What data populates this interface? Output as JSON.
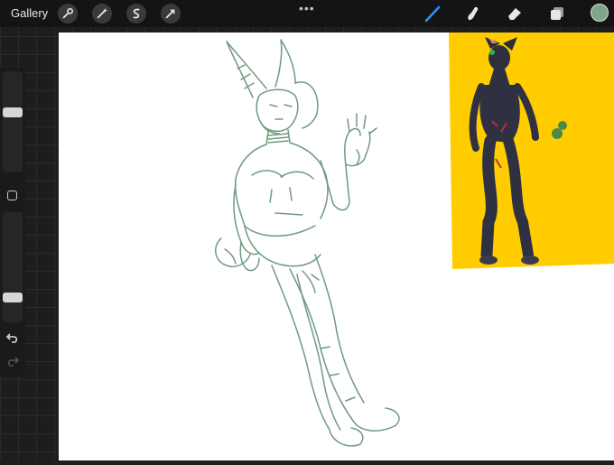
{
  "toolbar": {
    "gallery_label": "Gallery",
    "left_tools": [
      "wrench-icon",
      "magic-wand-icon",
      "selection-icon",
      "transform-arrow-icon"
    ],
    "more_label": "•••",
    "right_tools": [
      "brush-icon",
      "smudge-icon",
      "eraser-icon",
      "layers-icon"
    ],
    "active_tool": "brush",
    "active_color": "#7fa58c"
  },
  "sidebar": {
    "brush_size_fraction": 0.6,
    "opacity_fraction": 0.2
  },
  "canvas": {
    "reference_panel_color": "#ffcc00",
    "sketch_color": "#6f9a80"
  }
}
